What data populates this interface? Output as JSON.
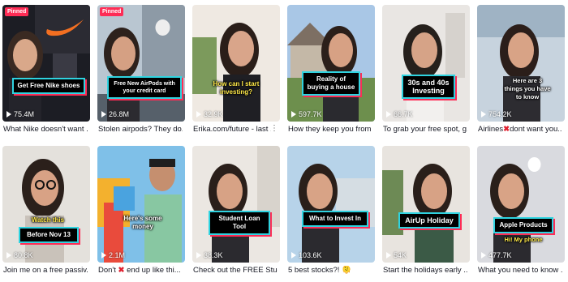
{
  "videos": [
    {
      "pinned": "Pinned",
      "caption": "Get Free Nike shoes",
      "views": "75.4M",
      "title": "What Nike doesn't want ..."
    },
    {
      "pinned": "Pinned",
      "caption": "Free New AirPods with your credit card",
      "views": "26.8M",
      "title": "Stolen airpods? They do..."
    },
    {
      "caption": "How can I start investing?",
      "views": "32.9K",
      "title": "Erika.com/future - last ..."
    },
    {
      "caption": "Reality of buying a house",
      "views": "597.7K",
      "title": "How they keep you from ..."
    },
    {
      "caption": "30s and 40s Investing",
      "views": "66.7K",
      "title": "To grab your free spot, g..."
    },
    {
      "caption": "Here are 3 things you have to know",
      "views": "754.2K",
      "title_before": "Airlines",
      "title_after": "dont want you..."
    },
    {
      "caption": "Watch this",
      "caption2": "Before Nov 13",
      "views": "80.8K",
      "title": "Join me on a free passiv..."
    },
    {
      "caption": "Here's some money",
      "views": "2.1M",
      "title_before": "Don't",
      "title_after": "end up like thi..."
    },
    {
      "caption": "Student Loan Tool",
      "views": "38.3K",
      "title": "Check out the FREE Stud..."
    },
    {
      "caption": "What to Invest In",
      "views": "103.6K",
      "title": "5 best stocks?!",
      "emoji": "🫠"
    },
    {
      "caption": "AirUp Holiday",
      "views": "54K",
      "title": "Start the holidays early ..."
    },
    {
      "caption": "Apple Products",
      "caption2": "Hi! My phone",
      "views": "477.7K",
      "title": "What you need to know ..."
    }
  ],
  "icons": {
    "more": "more-dots-icon",
    "play": "play-icon",
    "cross": "red-x-icon"
  },
  "colors": {
    "pinned": "#fe2c55",
    "accent_cyan": "#2fd3e0",
    "accent_red": "#fe2c55"
  }
}
